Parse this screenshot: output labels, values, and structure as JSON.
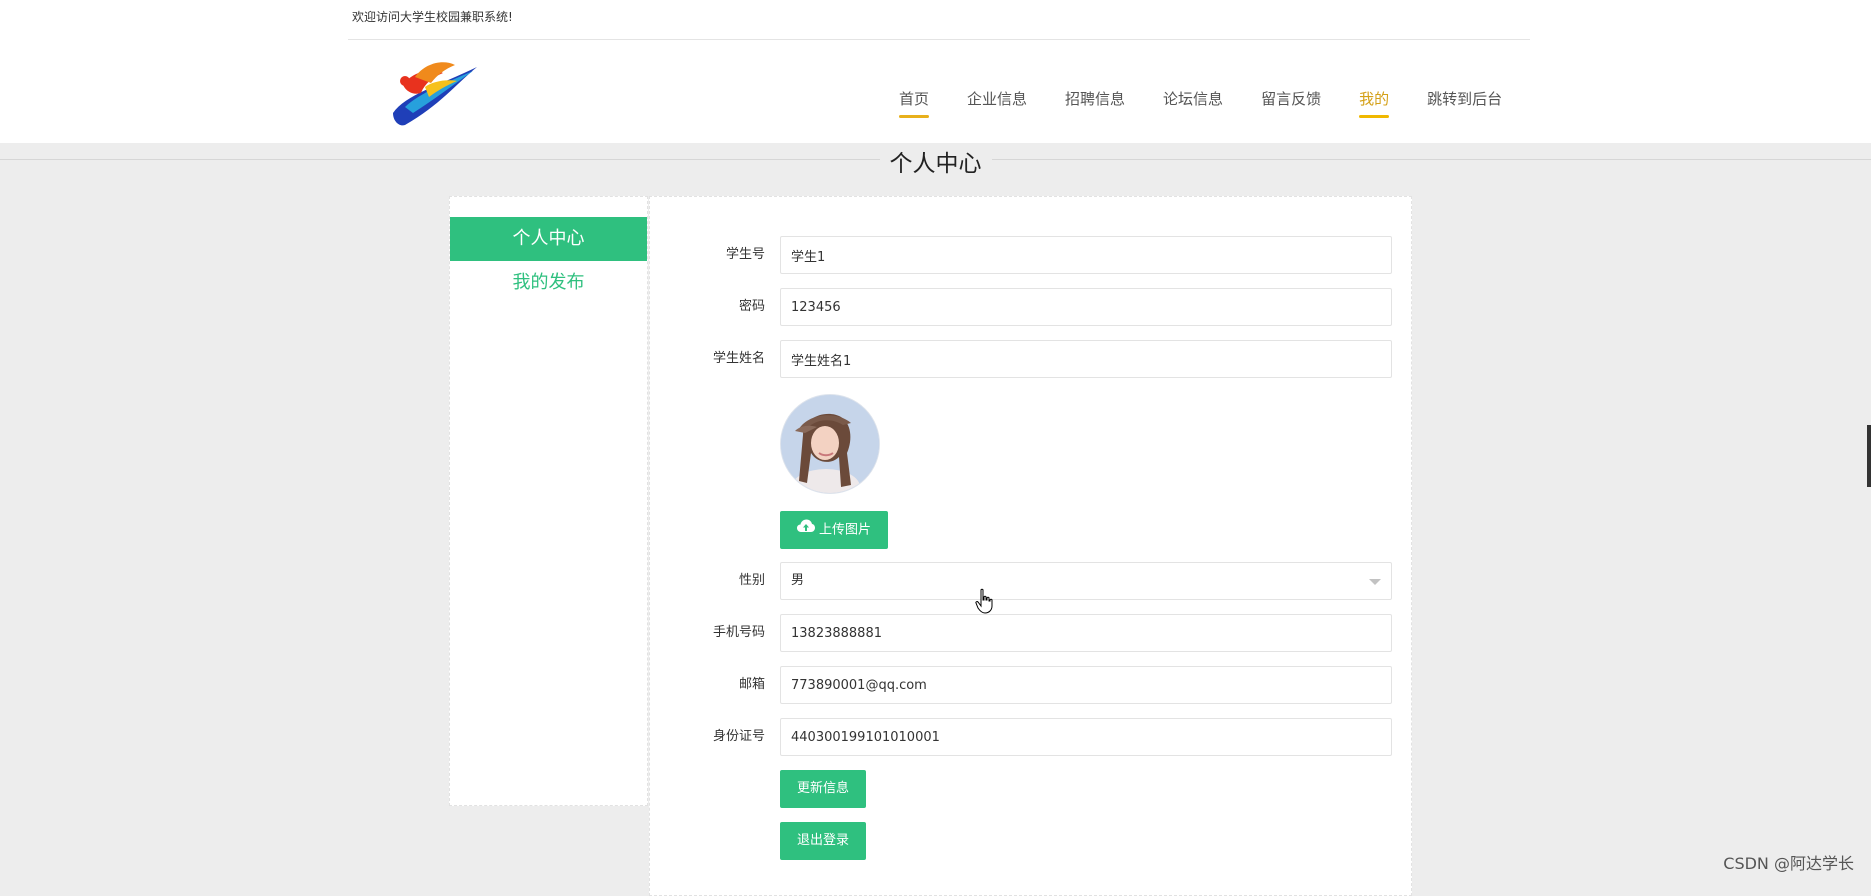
{
  "header": {
    "welcome": "欢迎访问大学生校园兼职系统!",
    "nav": [
      {
        "label": "首页",
        "state": "underline"
      },
      {
        "label": "企业信息",
        "state": ""
      },
      {
        "label": "招聘信息",
        "state": ""
      },
      {
        "label": "论坛信息",
        "state": ""
      },
      {
        "label": "留言反馈",
        "state": ""
      },
      {
        "label": "我的",
        "state": "active"
      },
      {
        "label": "跳转到后台",
        "state": ""
      }
    ]
  },
  "section": {
    "title": "个人中心"
  },
  "sidebar": {
    "items": [
      {
        "label": "个人中心",
        "active": true
      },
      {
        "label": "我的发布",
        "active": false
      }
    ]
  },
  "form": {
    "student_no": {
      "label": "学生号",
      "value": "学生1"
    },
    "password": {
      "label": "密码",
      "value": "123456"
    },
    "student_name": {
      "label": "学生姓名",
      "value": "学生姓名1"
    },
    "upload_label": "上传图片",
    "gender": {
      "label": "性别",
      "value": "男"
    },
    "phone": {
      "label": "手机号码",
      "value": "13823888881"
    },
    "email": {
      "label": "邮箱",
      "value": "773890001@qq.com"
    },
    "id_card": {
      "label": "身份证号",
      "value": "440300199101010001"
    },
    "update_label": "更新信息",
    "logout_label": "退出登录"
  },
  "watermark": "CSDN @阿达学长",
  "colors": {
    "accent_green": "#2fc07f",
    "nav_active": "#f0b800"
  }
}
